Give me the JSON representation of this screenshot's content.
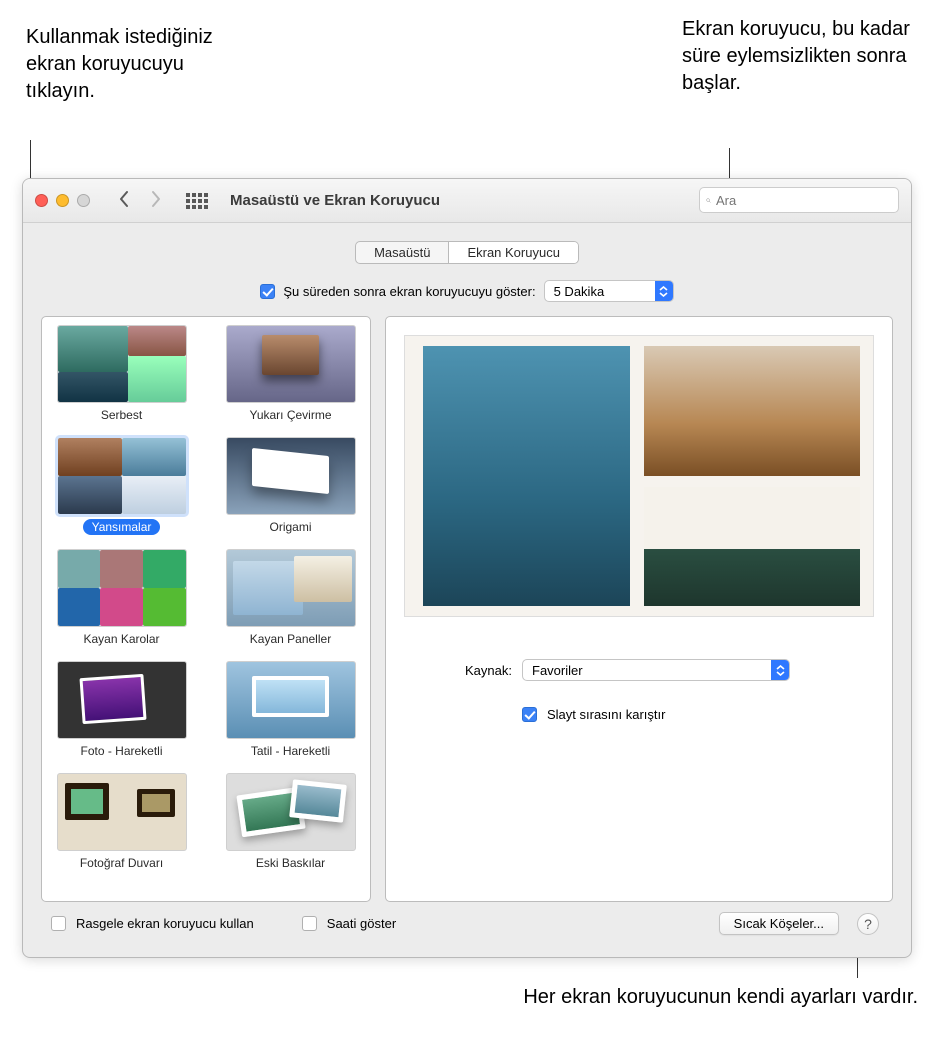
{
  "callouts": {
    "top_left": "Kullanmak istediğiniz ekran koruyucuyu tıklayın.",
    "top_right": "Ekran koruyucu, bu kadar süre eylemsizlikten sonra başlar.",
    "bottom_right": "Her ekran koruyucunun kendi ayarları vardır."
  },
  "window": {
    "title": "Masaüstü ve Ekran Koruyucu",
    "search_placeholder": "Ara"
  },
  "tabs": {
    "desktop": "Masaüstü",
    "screensaver": "Ekran Koruyucu"
  },
  "delay": {
    "checkbox_label": "Şu süreden sonra ekran koruyucuyu göster:",
    "value": "5 Dakika"
  },
  "thumbs": [
    {
      "label": "Serbest"
    },
    {
      "label": "Yukarı Çevirme"
    },
    {
      "label": "Yansımalar"
    },
    {
      "label": "Origami"
    },
    {
      "label": "Kayan Karolar"
    },
    {
      "label": "Kayan Paneller"
    },
    {
      "label": "Foto - Hareketli"
    },
    {
      "label": "Tatil - Hareketli"
    },
    {
      "label": "Fotoğraf Duvarı"
    },
    {
      "label": "Eski Baskılar"
    }
  ],
  "selected_index": 2,
  "options": {
    "source_label": "Kaynak:",
    "source_value": "Favoriler",
    "shuffle_label": "Slayt sırasını karıştır"
  },
  "bottom": {
    "random": "Rasgele ekran koruyucu kullan",
    "clock": "Saati göster",
    "hot_corners": "Sıcak Köşeler..."
  }
}
